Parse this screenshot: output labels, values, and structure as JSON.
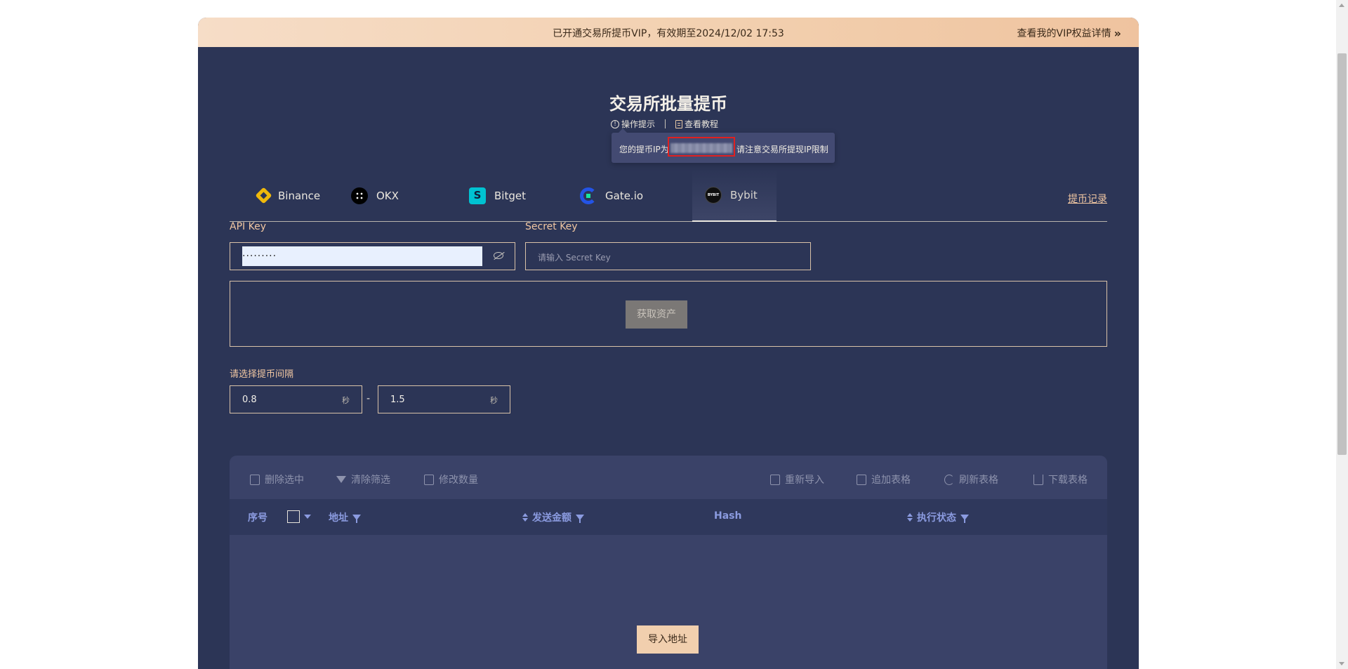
{
  "vip_banner": {
    "text": "已开通交易所提币VIP，有效期至2024/12/02 17:53",
    "link": "查看我的VIP权益详情",
    "link_arrow": "»"
  },
  "page": {
    "title": "交易所批量提币",
    "hint": "操作提示",
    "tutorial": "查看教程"
  },
  "tooltip": {
    "prefix": "您的提币IP为",
    "suffix": "请注意交易所提现IP限制"
  },
  "exchanges": [
    {
      "label": "Binance",
      "icon": "binance-logo"
    },
    {
      "label": "OKX",
      "icon": "okx-logo"
    },
    {
      "label": "Bitget",
      "icon": "bitget-logo"
    },
    {
      "label": "Gate.io",
      "icon": "gate-logo"
    },
    {
      "label": "Bybit",
      "icon": "bybit-logo",
      "active": true
    }
  ],
  "withdraw_record": "提币记录",
  "form": {
    "api_key_label": "API Key",
    "api_key_value": "·········",
    "secret_key_label": "Secret Key",
    "secret_key_placeholder": "请输入 Secret Key",
    "fetch_button": "获取资产"
  },
  "interval": {
    "label": "请选择提币间隔",
    "min": "0.8",
    "max": "1.5",
    "unit": "秒",
    "dash": "-"
  },
  "toolbar": {
    "delete_selected": "删除选中",
    "clear_filters": "清除筛选",
    "edit_amount": "修改数量",
    "reimport": "重新导入",
    "append_table": "追加表格",
    "refresh_table": "刷新表格",
    "download_table": "下载表格"
  },
  "table": {
    "columns": [
      "序号",
      "地址",
      "发送金额",
      "Hash",
      "执行状态"
    ]
  },
  "import_button": "导入地址",
  "colors": {
    "background": "#2c3556",
    "accent": "#f1c7a2",
    "header_text": "#8b9be0"
  }
}
